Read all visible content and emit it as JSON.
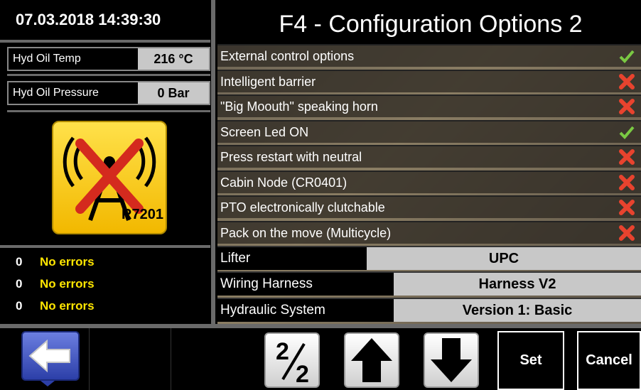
{
  "datetime": "07.03.2018 14:39:30",
  "sensors": [
    {
      "label": "Hyd Oil Temp",
      "value": "216 °C"
    },
    {
      "label": "Hyd Oil Pressure",
      "value": "0 Bar"
    }
  ],
  "status_icon": {
    "name": "antenna-disconnected-icon",
    "caption": "R7201"
  },
  "errors": [
    {
      "count": "0",
      "text": "No errors"
    },
    {
      "count": "0",
      "text": "No errors"
    },
    {
      "count": "0",
      "text": "No errors"
    }
  ],
  "title": "F4 - Configuration Options 2",
  "options": [
    {
      "label": "External control options",
      "enabled": true
    },
    {
      "label": "Intelligent barrier",
      "enabled": false
    },
    {
      "label": "\"Big Moouth\" speaking horn",
      "enabled": false
    },
    {
      "label": "Screen Led ON",
      "enabled": true
    },
    {
      "label": "Press restart with neutral",
      "enabled": false
    },
    {
      "label": "Cabin Node (CR0401)",
      "enabled": false
    },
    {
      "label": "PTO electronically clutchable",
      "enabled": false
    },
    {
      "label": "Pack on the move (Multicycle)",
      "enabled": false
    }
  ],
  "config": [
    {
      "label": "Lifter",
      "value": "UPC"
    },
    {
      "label": "Wiring Harness",
      "value": "Harness V2"
    },
    {
      "label": "Hydraulic System",
      "value": "Version 1: Basic"
    }
  ],
  "buttons": {
    "back_icon": "back-arrow-icon",
    "page_indicator": {
      "num": "2",
      "den": "2"
    },
    "up_icon": "arrow-up-icon",
    "down_icon": "arrow-down-icon",
    "set": "Set",
    "cancel": "Cancel"
  },
  "colors": {
    "check": "#7ac943",
    "cross": "#e8432e",
    "error_text": "#ffe600",
    "value_bg": "#c8c8c8"
  }
}
